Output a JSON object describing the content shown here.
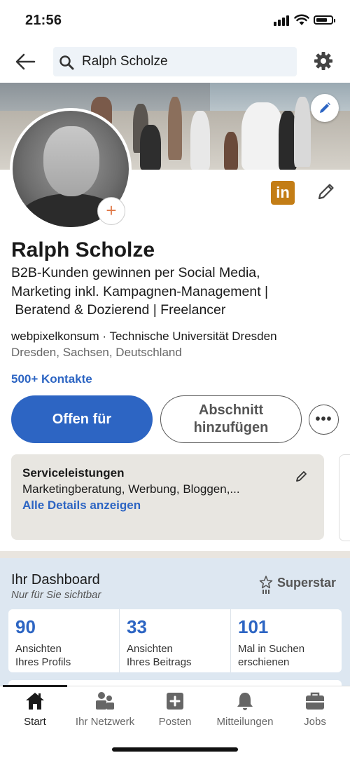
{
  "status_bar": {
    "time": "21:56"
  },
  "search": {
    "query": "Ralph Scholze"
  },
  "profile": {
    "name": "Ralph Scholze",
    "headline_lines": [
      "B2B-Kunden gewinnen per Social Media,",
      "Marketing inkl. Kampagnen-Management |",
      " Beratend & Dozierend | Freelancer"
    ],
    "company_education": "webpixelkonsum · Technische Universität Dresden",
    "location": "Dresden, Sachsen, Deutschland",
    "connections": "500+ Kontakte",
    "badge": "in"
  },
  "actions": {
    "primary_label": "Offen für",
    "secondary_label_line1": "Abschnitt",
    "secondary_label_line2": "hinzufügen",
    "more_label": "•••"
  },
  "services": {
    "title": "Serviceleistungen",
    "description": "Marketingberatung, Werbung, Bloggen,...",
    "link": "Alle Details anzeigen"
  },
  "dashboard": {
    "title": "Ihr Dashboard",
    "subtitle": "Nur für Sie sichtbar",
    "badge": "Superstar",
    "stats": [
      {
        "value": "90",
        "label_line1": "Ansichten",
        "label_line2": "Ihres Profils"
      },
      {
        "value": "33",
        "label_line1": "Ansichten",
        "label_line2": "Ihres Beitrags"
      },
      {
        "value": "101",
        "label_line1": "Mal in Suchen",
        "label_line2": "erschienen"
      }
    ]
  },
  "nav": {
    "items": [
      {
        "label": "Start",
        "icon": "home-icon"
      },
      {
        "label": "Ihr Netzwerk",
        "icon": "network-icon"
      },
      {
        "label": "Posten",
        "icon": "post-icon"
      },
      {
        "label": "Mitteilungen",
        "icon": "bell-icon"
      },
      {
        "label": "Jobs",
        "icon": "briefcase-icon"
      }
    ]
  },
  "colors": {
    "accent": "#2d65c3",
    "linkedin_badge": "#c37d16",
    "dashboard_bg": "#dde7f1",
    "service_card_bg": "#e8e6e1"
  }
}
